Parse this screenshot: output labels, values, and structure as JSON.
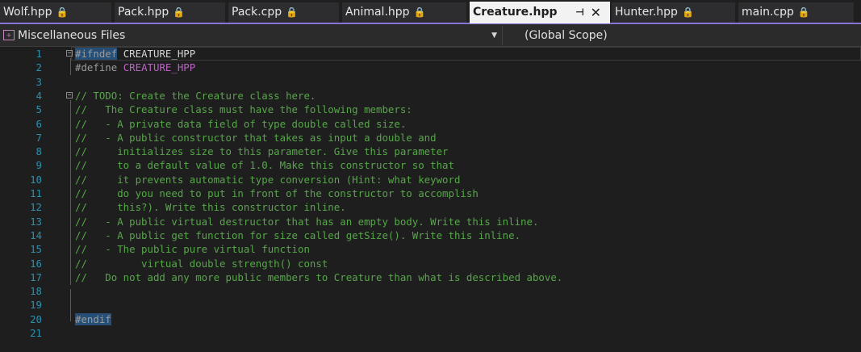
{
  "tabs": [
    {
      "label": "Wolf.hpp",
      "locked": true
    },
    {
      "label": "Pack.hpp",
      "locked": true
    },
    {
      "label": "Pack.cpp",
      "locked": true
    },
    {
      "label": "Animal.hpp",
      "locked": true
    },
    {
      "label": "Creature.hpp",
      "active": true
    },
    {
      "label": "Hunter.hpp",
      "locked": true
    },
    {
      "label": "main.cpp",
      "locked": true
    }
  ],
  "lock_glyph": "🔒",
  "pin_glyph": "⊣",
  "close_glyph": "✕",
  "navbar": {
    "project": "Miscellaneous Files",
    "scope": "(Global Scope)",
    "dropdown_glyph": "▼"
  },
  "lines": [
    {
      "n": "1",
      "pp": "#ifndef",
      "macro": "CREATURE_HPP"
    },
    {
      "n": "2",
      "pp": "#define",
      "macro": "CREATURE_HPP"
    },
    {
      "n": "3"
    },
    {
      "n": "4",
      "cm": "// TODO: Create the Creature class here."
    },
    {
      "n": "5",
      "cm": "//   The Creature class must have the following members:"
    },
    {
      "n": "6",
      "cm": "//   - A private data field of type double called size."
    },
    {
      "n": "7",
      "cm": "//   - A public constructor that takes as input a double and"
    },
    {
      "n": "8",
      "cm": "//     initializes size to this parameter. Give this parameter"
    },
    {
      "n": "9",
      "cm": "//     to a default value of 1.0. Make this constructor so that"
    },
    {
      "n": "10",
      "cm": "//     it prevents automatic type conversion (Hint: what keyword"
    },
    {
      "n": "11",
      "cm": "//     do you need to put in front of the constructor to accomplish"
    },
    {
      "n": "12",
      "cm": "//     this?). Write this constructor inline."
    },
    {
      "n": "13",
      "cm": "//   - A public virtual destructor that has an empty body. Write this inline."
    },
    {
      "n": "14",
      "cm": "//   - A public get function for size called getSize(). Write this inline."
    },
    {
      "n": "15",
      "cm": "//   - The public pure virtual function"
    },
    {
      "n": "16",
      "cm": "//         virtual double strength() const"
    },
    {
      "n": "17",
      "cm": "//   Do not add any more public members to Creature than what is described above."
    },
    {
      "n": "18"
    },
    {
      "n": "19"
    },
    {
      "n": "20",
      "pp": "#endif"
    },
    {
      "n": "21"
    }
  ]
}
